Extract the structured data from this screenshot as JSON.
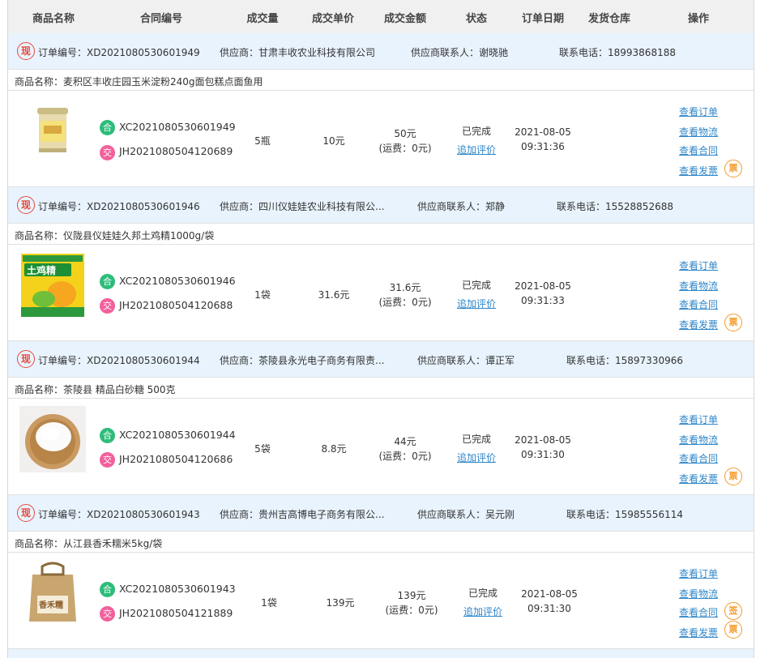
{
  "headers": {
    "product_name": "商品名称",
    "contract_no": "合同编号",
    "quantity": "成交量",
    "unit_price": "成交单价",
    "amount": "成交金额",
    "status": "状态",
    "order_date": "订单日期",
    "warehouse": "发货仓库",
    "actions": "操作"
  },
  "labels": {
    "order_badge": "现",
    "contract_icon": "合",
    "delivery_icon": "交",
    "invoice_badge": "票",
    "sign_badge": "签"
  },
  "orders": [
    {
      "order_no": "订单编号：XD2021080530601949",
      "supplier": "供应商：甘肃丰收农业科技有限公司",
      "contact": "供应商联系人：谢晓驰",
      "phone": "联系电话：18993868188",
      "product": "商品名称：麦积区丰收庄园玉米淀粉240g面包糕点面鱼用",
      "contract_code": "XC2021080530601949",
      "delivery_code": "JH2021080504120689",
      "quantity": "5瓶",
      "unit_price": "10元",
      "amount": "50元",
      "shipping": "(运费：0元)",
      "status": "已完成",
      "add_review": "追加评价",
      "date": "2021-08-05",
      "time": "09:31:36",
      "actions": [
        "查看订单",
        "查看物流",
        "查看合同",
        "查看发票"
      ],
      "thumb": "starch-can-icon"
    },
    {
      "order_no": "订单编号：XD2021080530601946",
      "supplier": "供应商：四川仪娃娃农业科技有限公...",
      "contact": "供应商联系人：郑静",
      "phone": "联系电话：15528852688",
      "product": "商品名称：仪陇县仪娃娃久邦土鸡精1000g/袋",
      "contract_code": "XC2021080530601946",
      "delivery_code": "JH2021080504120688",
      "quantity": "1袋",
      "unit_price": "31.6元",
      "amount": "31.6元",
      "shipping": "(运费：0元)",
      "status": "已完成",
      "add_review": "追加评价",
      "date": "2021-08-05",
      "time": "09:31:33",
      "actions": [
        "查看订单",
        "查看物流",
        "查看合同",
        "查看发票"
      ],
      "thumb": "chicken-bouillon-bag-icon",
      "thumb_text": "土鸡精"
    },
    {
      "order_no": "订单编号：XD2021080530601944",
      "supplier": "供应商：茶陵县永光电子商务有限责...",
      "contact": "供应商联系人：谭正军",
      "phone": "联系电话：15897330966",
      "product": "商品名称：茶陵县 精品白砂糖 500克",
      "contract_code": "XC2021080530601944",
      "delivery_code": "JH2021080504120686",
      "quantity": "5袋",
      "unit_price": "8.8元",
      "amount": "44元",
      "shipping": "(运费：0元)",
      "status": "已完成",
      "add_review": "追加评价",
      "date": "2021-08-05",
      "time": "09:31:30",
      "actions": [
        "查看订单",
        "查看物流",
        "查看合同",
        "查看发票"
      ],
      "thumb": "sugar-bowl-icon"
    },
    {
      "order_no": "订单编号：XD2021080530601943",
      "supplier": "供应商：贵州吉高博电子商务有限公...",
      "contact": "供应商联系人：吴元刚",
      "phone": "联系电话：15985556114",
      "product": "商品名称：从江县香禾糯米5kg/袋",
      "contract_code": "XC2021080530601943",
      "delivery_code": "JH2021080504121889",
      "quantity": "1袋",
      "unit_price": "139元",
      "amount": "139元",
      "shipping": "(运费：0元)",
      "status": "已完成",
      "add_review": "追加评价",
      "date": "2021-08-05",
      "time": "09:31:30",
      "actions": [
        "查看订单",
        "查看物流",
        "查看合同",
        "查看发票"
      ],
      "thumb": "rice-bag-icon",
      "thumb_text": "香禾糯",
      "has_sign": true
    }
  ]
}
